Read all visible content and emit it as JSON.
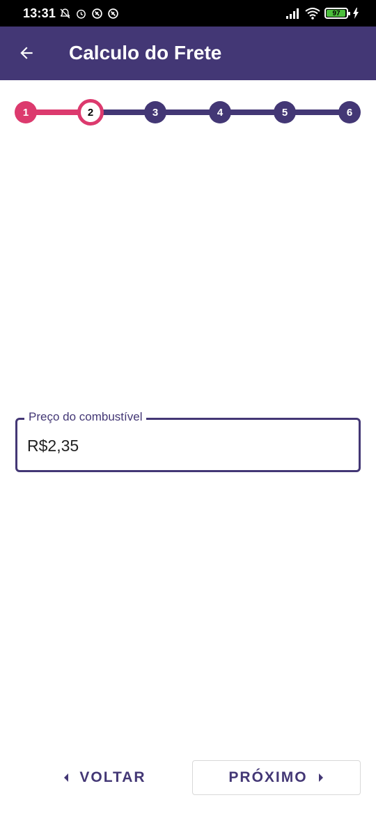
{
  "status_bar": {
    "time": "13:31",
    "battery": "97",
    "battery_level": 0.97,
    "left_icons": [
      "notifications-off-icon",
      "alarm-icon",
      "app-icon-1",
      "app-icon-2"
    ],
    "right_icons": [
      "signal-icon",
      "wifi-icon",
      "battery-icon",
      "charging-bolt-icon"
    ]
  },
  "app_bar": {
    "title": "Calculo do Frete",
    "back_icon": "arrow-left-icon"
  },
  "stepper": {
    "steps": [
      "1",
      "2",
      "3",
      "4",
      "5",
      "6"
    ],
    "current_step": 2,
    "colors": {
      "done": "#dc3a6e",
      "todo": "#433775"
    }
  },
  "form": {
    "fuel_price_label": "Preço do combustível",
    "fuel_price_value": "R$2,35"
  },
  "navigation": {
    "back_label": "VOLTAR",
    "next_label": "PRÓXIMO",
    "back_icon": "caret-left-icon",
    "next_icon": "caret-right-icon"
  },
  "colors": {
    "primary": "#433775",
    "accent": "#dc3a6e"
  }
}
